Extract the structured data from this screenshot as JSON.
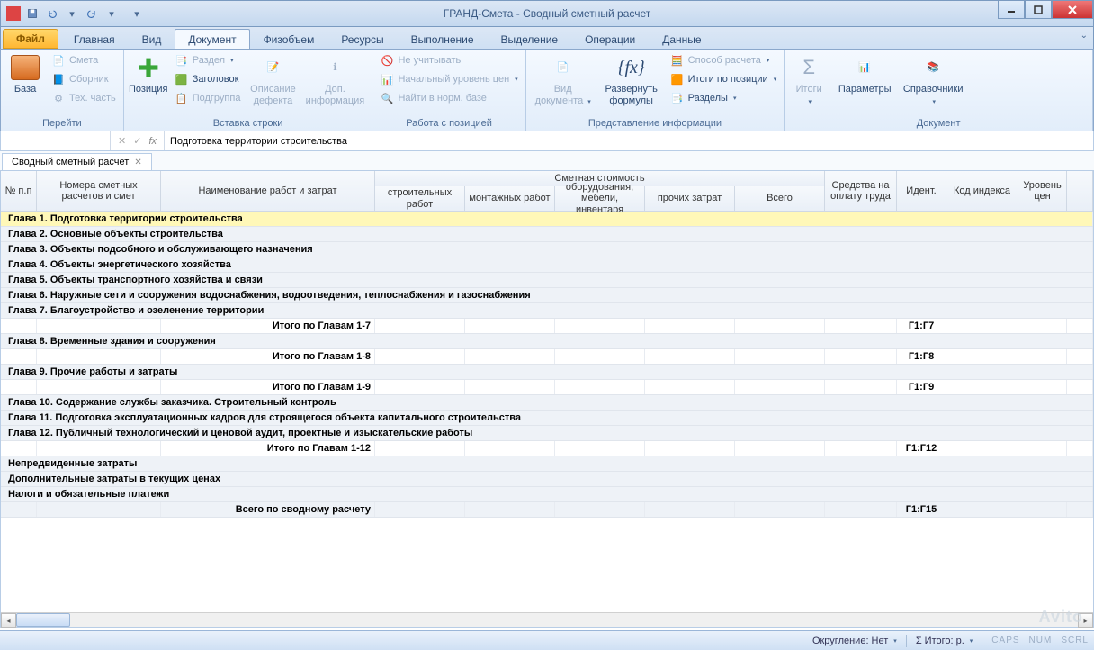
{
  "window": {
    "title": "ГРАНД-Смета - Сводный сметный расчет"
  },
  "ribbon": {
    "file_tab": "Файл",
    "tabs": [
      "Главная",
      "Вид",
      "Документ",
      "Физобъем",
      "Ресурсы",
      "Выполнение",
      "Выделение",
      "Операции",
      "Данные"
    ],
    "active_tab": "Документ",
    "groups": {
      "perejti": {
        "label": "Перейти",
        "baza": "База",
        "smeta": "Смета",
        "sbornik": "Сборник",
        "tech_chast": "Тех. часть"
      },
      "vstavka": {
        "label": "Вставка строки",
        "pozitsiya": "Позиция",
        "razdel": "Раздел",
        "zagolovok": "Заголовок",
        "podgruppa": "Подгруппа",
        "opis_defekta": "Описание дефекта",
        "dop_info": "Доп. информация"
      },
      "rabota": {
        "label": "Работа с позицией",
        "ne_uchityvat": "Не учитывать",
        "nach_uroven": "Начальный уровень цен",
        "najti_norm": "Найти в норм. базе"
      },
      "predstavlenie": {
        "label": "Представление информации",
        "vid_dokumenta": "Вид документа",
        "razvernut_formuly": "Развернуть формулы",
        "sposob_rascheta": "Способ расчета",
        "itogi_po_pozitsii": "Итоги по позиции",
        "razdely": "Разделы"
      },
      "dokument": {
        "label": "Документ",
        "itogi": "Итоги",
        "parametry": "Параметры",
        "spravochniki": "Справочники"
      }
    }
  },
  "formula_bar": {
    "fx": "fx",
    "text": "Подготовка территории строительства"
  },
  "doc_tab": {
    "label": "Сводный сметный расчет"
  },
  "grid": {
    "headers": {
      "np": "№ п.п",
      "nomera": "Номера сметных расчетов и смет",
      "naim": "Наименование работ и затрат",
      "smet_stoim": "Сметная стоимость",
      "stroit": "строительных работ",
      "montazh": "монтажных работ",
      "oborud": "оборудования, мебели, инвентаря",
      "prochih": "прочих затрат",
      "vsego": "Всего",
      "sredstva": "Средства на оплату труда",
      "ident": "Идент.",
      "kod": "Код индекса",
      "uroven": "Уровень цен"
    },
    "rows": [
      {
        "type": "chapter",
        "hl": true,
        "text": "Глава 1. Подготовка территории строительства"
      },
      {
        "type": "chapter",
        "text": "Глава 2. Основные объекты строительства"
      },
      {
        "type": "chapter",
        "text": "Глава 3. Объекты подсобного и обслуживающего назначения"
      },
      {
        "type": "chapter",
        "text": "Глава 4. Объекты энергетического хозяйства"
      },
      {
        "type": "chapter",
        "text": "Глава 5. Объекты транспортного хозяйства и связи"
      },
      {
        "type": "chapter",
        "text": "Глава 6. Наружные сети и сооружения водоснабжения, водоотведения, теплоснабжения и газоснабжения"
      },
      {
        "type": "chapter",
        "text": "Глава 7. Благоустройство и озеленение территории"
      },
      {
        "type": "subtotal",
        "text": "Итого по Главам 1-7",
        "ident": "Г1:Г7"
      },
      {
        "type": "chapter",
        "text": "Глава 8. Временные здания и сооружения"
      },
      {
        "type": "subtotal",
        "text": "Итого по Главам 1-8",
        "ident": "Г1:Г8"
      },
      {
        "type": "chapter",
        "text": "Глава 9. Прочие работы и затраты"
      },
      {
        "type": "subtotal",
        "text": "Итого по Главам 1-9",
        "ident": "Г1:Г9"
      },
      {
        "type": "chapter",
        "text": "Глава 10. Содержание службы заказчика. Строительный контроль"
      },
      {
        "type": "chapter",
        "text": "Глава 11. Подготовка эксплуатационных кадров для строящегося объекта капитального строительства"
      },
      {
        "type": "chapter",
        "text": "Глава 12. Публичный технологический и ценовой аудит, проектные и изыскательские работы"
      },
      {
        "type": "subtotal",
        "text": "Итого по Главам 1-12",
        "ident": "Г1:Г12"
      },
      {
        "type": "chapter",
        "text": "Непредвиденные затраты"
      },
      {
        "type": "chapter",
        "text": "Дополнительные затраты в текущих ценах"
      },
      {
        "type": "chapter",
        "text": "Налоги и обязательные платежи"
      },
      {
        "type": "total",
        "text": "Всего по сводному расчету",
        "ident": "Г1:Г15"
      }
    ]
  },
  "statusbar": {
    "okruglenie": "Округление: Нет",
    "itogo": "Σ Итого: р.",
    "caps": "CAPS",
    "num": "NUM",
    "scrl": "SCRL"
  },
  "watermark": "Avito"
}
